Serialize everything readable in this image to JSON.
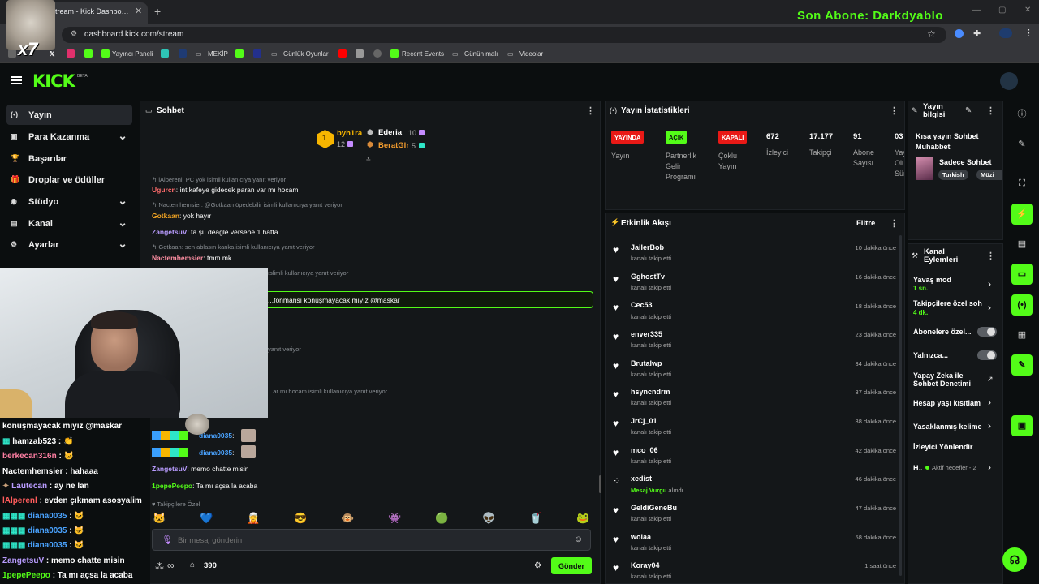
{
  "browser": {
    "tab_title": "Stream - Kick Dashboard",
    "url": "dashboard.kick.com/stream",
    "bookmarks": [
      "Yayıncı Paneli",
      "MEKİP",
      "Günlük Oyunlar",
      "Recent Events",
      "Günün malı",
      "Videolar"
    ],
    "overlay_text": "Son Abone: Darkdyablo",
    "badge_x7": "x7"
  },
  "header": {
    "logo": "KICK",
    "beta": "BETA"
  },
  "sidebar": {
    "items": [
      {
        "icon": "(•)",
        "label": "Yayın"
      },
      {
        "icon": "▣",
        "label": "Para Kazanma"
      },
      {
        "icon": "🏆",
        "label": "Başarılar"
      },
      {
        "icon": "🎁",
        "label": "Droplar ve ödüller"
      },
      {
        "icon": "◉",
        "label": "Stüdyo"
      },
      {
        "icon": "▤",
        "label": "Kanal"
      },
      {
        "icon": "⚙",
        "label": "Ayarlar"
      }
    ]
  },
  "chat": {
    "title": "Sohbet",
    "leaderboard": {
      "first_rank": "1",
      "first_name": "byh1ra",
      "first_count": "12",
      "second_name": "Ederia",
      "second_count": "10",
      "third_name": "BeratGlr",
      "third_count": "5"
    },
    "messages": [
      {
        "reply": "lAlperenl: PC yok isimli kullanıcıya yanıt veriyor",
        "user": "Ugurcn",
        "text": ": int kafeye gidecek paran var mı hocam"
      },
      {
        "reply": "Nactemhemsier: @Gotkaan öpedebilir  isimli kullanıcıya yanıt veriyor",
        "user": "Gotkaan",
        "text": ": yok hayır"
      },
      {
        "user": "ZangetsuV",
        "text": ": ta şu deagle versene 1 hafta"
      },
      {
        "reply": "Gotkaan: sen ablasın kanka isimli kullanıcıya yanıt veriyor",
        "user": "Nactemhemsier",
        "text": ": tmm mk"
      },
      {
        "reply": "ıslimli kullanıcıya yanıt veriyor"
      },
      {
        "pinned": "...fonmansı konuşmayacak mıyız @maskar"
      },
      {
        "reply": "yanıt veriyor"
      },
      {
        "reply": "...ar mı hocam isimli kullanıcıya yanıt veriyor"
      },
      {
        "user": "diana0035",
        "text": ":"
      },
      {
        "user": "diana0035",
        "text": ":"
      },
      {
        "user": "ZangetsuV",
        "text": ": memo chatte misin"
      },
      {
        "user": "1pepePeepo",
        "text": ": Ta mı açsa la acaba"
      }
    ],
    "followers_only": "Takipçilere Özel",
    "input_placeholder": "Bir mesaj gönderin",
    "points_infinite": "∞",
    "points": "390",
    "send_label": "Gönder",
    "emotes": [
      "🐱",
      "💙",
      "🧝",
      "😎",
      "🐵",
      "👾",
      "🟢",
      "👽",
      "🥤",
      "🐸"
    ]
  },
  "stats": {
    "title": "Yayın İstatistikleri",
    "badges": [
      {
        "label": "YAYINDA",
        "caption": "Yayın"
      },
      {
        "label": "AÇIK",
        "caption": "Partnerlik Gelir Programı"
      },
      {
        "label": "KAPALI",
        "caption": "Çoklu Yayın"
      }
    ],
    "numbers": [
      {
        "value": "672",
        "caption": "İzleyici"
      },
      {
        "value": "17.177",
        "caption": "Takipçi"
      },
      {
        "value": "91",
        "caption": "Abone Sayısı"
      },
      {
        "value": "03",
        "caption": "Yay Olu Sür"
      }
    ]
  },
  "activity": {
    "title": "Etkinlik Akışı",
    "filter": "Filtre",
    "events": [
      {
        "name": "JailerBob",
        "sub": "kanalı takip etti",
        "time": "10 dakika önce"
      },
      {
        "name": "GghostTv",
        "sub": "kanalı takip etti",
        "time": "16 dakika önce"
      },
      {
        "name": "Cec53",
        "sub": "kanalı takip etti",
        "time": "18 dakika önce"
      },
      {
        "name": "enver335",
        "sub": "kanalı takip etti",
        "time": "23 dakika önce"
      },
      {
        "name": "Brutalwp",
        "sub": "kanalı takip etti",
        "time": "34 dakika önce"
      },
      {
        "name": "hsyncndrm",
        "sub": "kanalı takip etti",
        "time": "37 dakika önce"
      },
      {
        "name": "JrCj_01",
        "sub": "kanalı takip etti",
        "time": "38 dakika önce"
      },
      {
        "name": "mco_06",
        "sub": "kanalı takip etti",
        "time": "42 dakika önce"
      },
      {
        "name": "xedist",
        "sub_highlight": "Mesaj Vurgu",
        "sub": " alındı",
        "time": "46 dakika önce"
      },
      {
        "name": "GeldiGeneBu",
        "sub": "kanalı takip etti",
        "time": "47 dakika önce"
      },
      {
        "name": "wolaa",
        "sub": "kanalı takip etti",
        "time": "58 dakika önce"
      },
      {
        "name": "Koray04",
        "sub": "kanalı takip etti",
        "time": "1 saat önce"
      }
    ]
  },
  "stream_info": {
    "title": "Yayın bilgisi",
    "stream_title": "Kısa yayın Sohbet Muhabbet",
    "category": "Sadece Sohbet",
    "tags": [
      "Turkish",
      "Müzi"
    ]
  },
  "channel_actions": {
    "title": "Kanal Eylemleri",
    "slow_mode": "Yavaş mod",
    "slow_mode_val": "1 sn.",
    "followers_chat": "Takipçilere özel soh",
    "followers_chat_val": "4 dk.",
    "subs_only": "Abonelere özel...",
    "only": "Yalnızca...",
    "ai_moderation": "Yapay Zeka ile Sohbet Denetimi",
    "account_age": "Hesap yaşı kısıtlam",
    "banned_words": "Yasaklanmış kelime",
    "viewer_redirect": "İzleyici Yönlendir",
    "goals_prefix": "H..",
    "goals": "Aktif hedefler - 2"
  },
  "overlay_chat": [
    {
      "user": "",
      "text": "konuşmayacak mıyız @maskar",
      "color": "#ffffff"
    },
    {
      "user": "hamzab523",
      "text": " : 👏",
      "color": "#ffffff"
    },
    {
      "user": "berkecan316n",
      "text": " : 🐱",
      "color": "#ff7fa3"
    },
    {
      "user": "Nactemhemsier",
      "text": " : hahaaa",
      "color": "#ffffff"
    },
    {
      "user": "Lautecan",
      "text": " : ay ne lan",
      "color": "#b99cff"
    },
    {
      "user": "lAlperenl",
      "text": " : evden çıkmam asosyalim",
      "color": "#ff5c5c"
    },
    {
      "user": "diana0035",
      "text": " : 🐱",
      "color": "#4aa3ff"
    },
    {
      "user": "diana0035",
      "text": " : 🐱",
      "color": "#4aa3ff"
    },
    {
      "user": "diana0035",
      "text": " : 🐱",
      "color": "#4aa3ff"
    },
    {
      "user": "ZangetsuV",
      "text": " : memo chatte misin",
      "color": "#b99cff"
    },
    {
      "user": "1pepePeepo",
      "text": " : Ta mı açsa la acaba",
      "color": "#53fc18"
    }
  ],
  "colors": {
    "accent": "#53fc18",
    "live": "#e91916",
    "panel": "#141719"
  }
}
